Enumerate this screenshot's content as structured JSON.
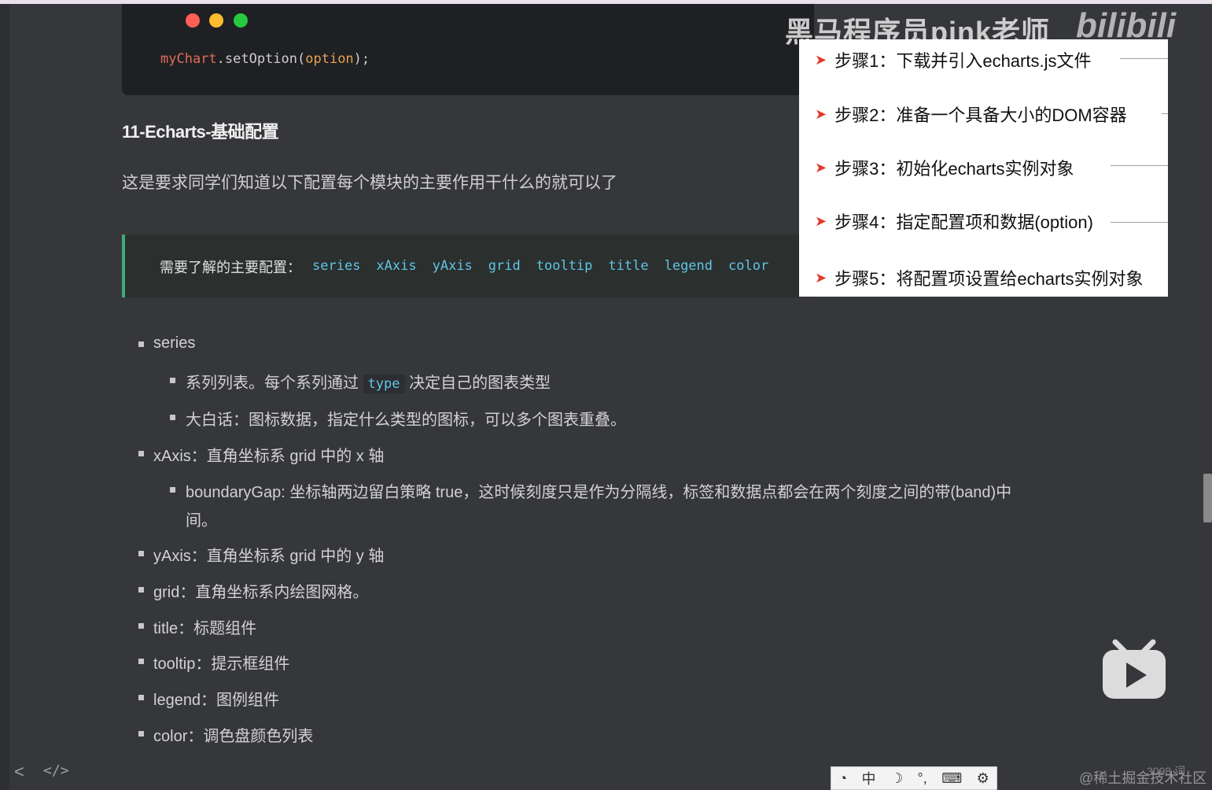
{
  "code": {
    "var": "myChart",
    "method": ".setOption(",
    "arg": "option",
    "close": ");"
  },
  "heading": "11-Echarts-基础配置",
  "intro": "这是要求同学们知道以下配置每个模块的主要作用干什么的就可以了",
  "callout": {
    "label": "需要了解的主要配置：",
    "items": [
      "series",
      "xAxis",
      "yAxis",
      "grid",
      "tooltip",
      "title",
      "legend",
      "color"
    ]
  },
  "list": {
    "series": "series",
    "series_sub1_pre": "系列列表。每个系列通过",
    "series_sub1_code": "type",
    "series_sub1_post": "决定自己的图表类型",
    "series_sub2": "大白话：图标数据，指定什么类型的图标，可以多个图表重叠。",
    "xaxis": "xAxis：直角坐标系 grid 中的 x 轴",
    "xaxis_sub1_line1": "boundaryGap: 坐标轴两边留白策略 true，这时候刻度只是作为分隔线，标签和数据点都会在两个刻度之间的带(band)中",
    "xaxis_sub1_line2": "间。",
    "yaxis": "yAxis：直角坐标系 grid 中的 y 轴",
    "grid": "grid：直角坐标系内绘图网格。",
    "title": "title：标题组件",
    "tooltip": "tooltip：提示框组件",
    "legend": "legend：图例组件",
    "color": "color：调色盘颜色列表"
  },
  "overlay": {
    "brand": "黑马程序员pink老师",
    "brand2": "bilibili",
    "steps": [
      "步骤1：下载并引入echarts.js文件",
      "步骤2：准备一个具备大小的DOM容器",
      "步骤3：初始化echarts实例对象",
      "步骤4：指定配置项和数据(option)",
      "步骤5：将配置项设置给echarts实例对象"
    ]
  },
  "footer": {
    "prev": "<",
    "code_toggle": "</>",
    "ime": [
      "中",
      "☽",
      "°,",
      "⌨",
      "⚙"
    ],
    "watermark": "@稀土掘金技术社区",
    "word_count": "3098 词"
  },
  "colors": {
    "accent_green": "#41a97a",
    "code_cyan": "#5fc6e8",
    "step_arrow": "#e23b2e"
  }
}
